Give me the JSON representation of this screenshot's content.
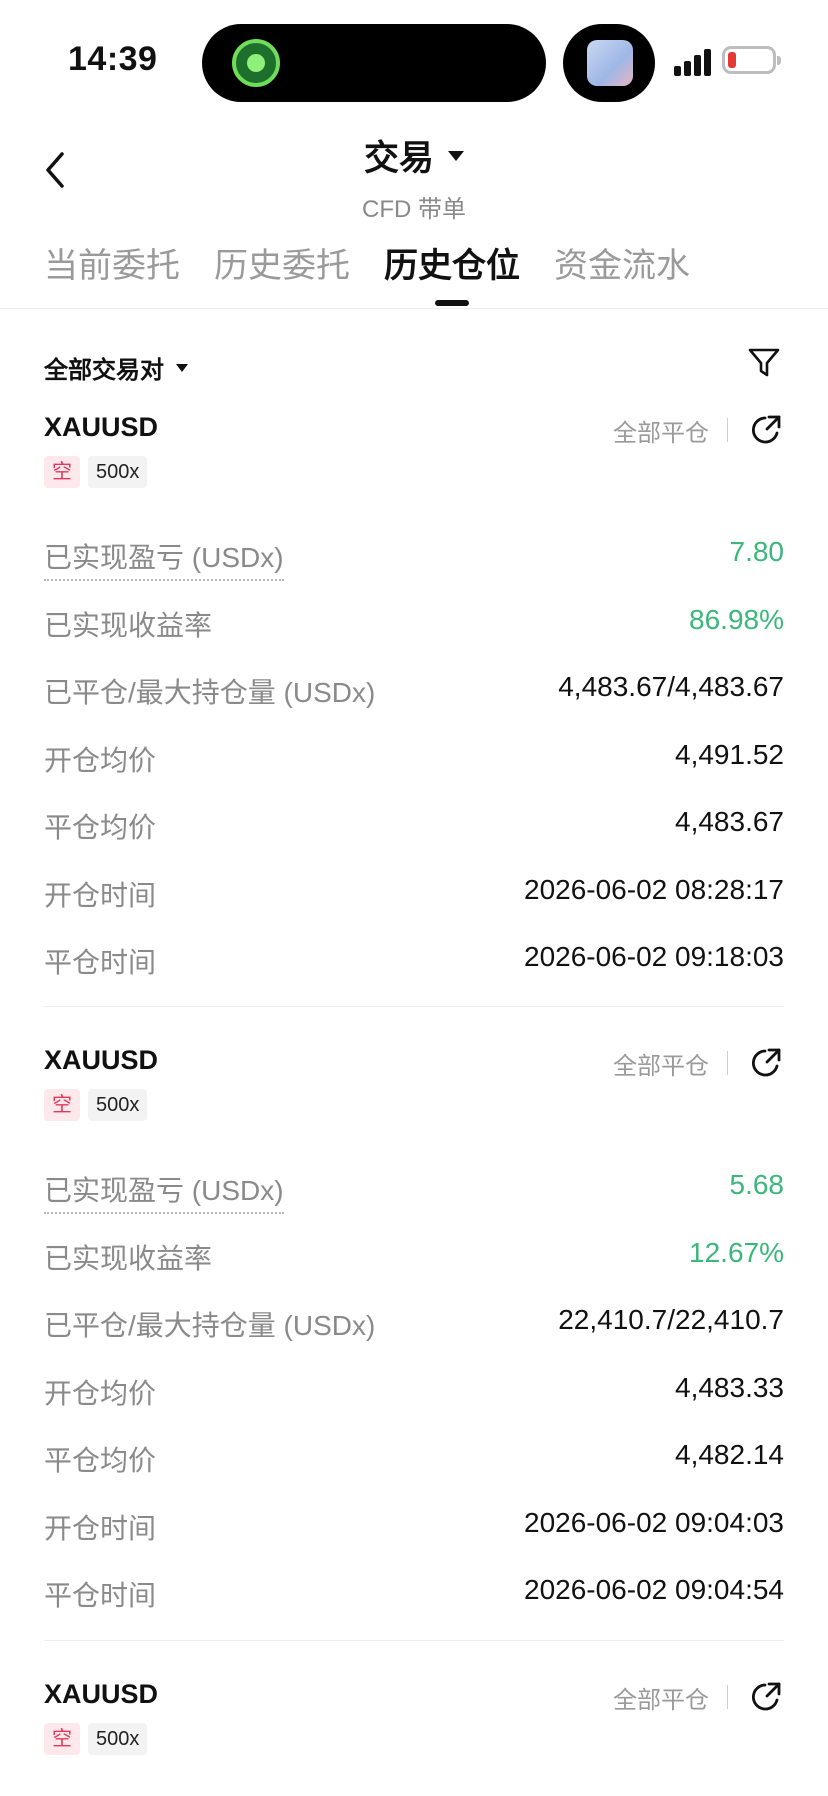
{
  "status": {
    "time": "14:39"
  },
  "header": {
    "title": "交易",
    "subtitle": "CFD 带单"
  },
  "tabs": [
    {
      "label": "当前委托",
      "active": false
    },
    {
      "label": "历史委托",
      "active": false
    },
    {
      "label": "历史仓位",
      "active": true
    },
    {
      "label": "资金流水",
      "active": false
    }
  ],
  "filter": {
    "label": "全部交易对"
  },
  "colors": {
    "positive": "#3cb77b",
    "short_tag": "#e0395b",
    "muted": "#8a8a8a"
  },
  "positions": [
    {
      "symbol": "XAUUSD",
      "side": "空",
      "leverage": "500x",
      "close_all": "全部平仓",
      "rows": [
        {
          "label": "已实现盈亏 (USDx)",
          "value": "7.80"
        },
        {
          "label": "已实现收益率",
          "value": "86.98%"
        },
        {
          "label": "已平仓/最大持仓量 (USDx)",
          "value": "4,483.67/4,483.67"
        },
        {
          "label": "开仓均价",
          "value": "4,491.52"
        },
        {
          "label": "平仓均价",
          "value": "4,483.67"
        },
        {
          "label": "开仓时间",
          "value": "2026-06-02 08:28:17"
        },
        {
          "label": "平仓时间",
          "value": "2026-06-02 09:18:03"
        }
      ]
    },
    {
      "symbol": "XAUUSD",
      "side": "空",
      "leverage": "500x",
      "close_all": "全部平仓",
      "rows": [
        {
          "label": "已实现盈亏 (USDx)",
          "value": "5.68"
        },
        {
          "label": "已实现收益率",
          "value": "12.67%"
        },
        {
          "label": "已平仓/最大持仓量 (USDx)",
          "value": "22,410.7/22,410.7"
        },
        {
          "label": "开仓均价",
          "value": "4,483.33"
        },
        {
          "label": "平仓均价",
          "value": "4,482.14"
        },
        {
          "label": "开仓时间",
          "value": "2026-06-02 09:04:03"
        },
        {
          "label": "平仓时间",
          "value": "2026-06-02 09:04:54"
        }
      ]
    },
    {
      "symbol": "XAUUSD",
      "side": "空",
      "leverage": "500x",
      "close_all": "全部平仓",
      "rows": []
    }
  ]
}
